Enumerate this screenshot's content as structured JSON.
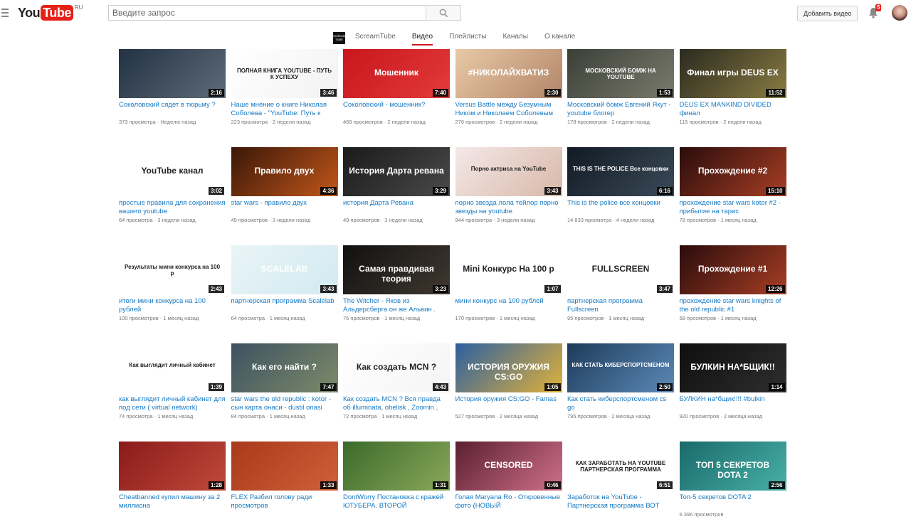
{
  "header": {
    "logo_you": "You",
    "logo_tube": "Tube",
    "logo_region": "RU",
    "search_placeholder": "Введите запрос",
    "upload_label": "Добавить видео",
    "notification_count": "5"
  },
  "channel": {
    "name": "ScreamTube",
    "thumb_text": "SCREAM TUBE",
    "tabs": [
      "Видео",
      "Плейлисты",
      "Каналы",
      "О канале"
    ],
    "active_tab": "Видео"
  },
  "videos": [
    {
      "title": "Соколовский сядет в тюрьму ?",
      "views": "373 просмотра",
      "age": "Неделю назад",
      "duration": "2:16",
      "thumb_text": "",
      "thumb_colors": [
        "#223244",
        "#5f6b78"
      ]
    },
    {
      "title": "Наше мнение о книге Николая Соболева - \"YouTube: Путь к",
      "views": "223 просмотра",
      "age": "2 недели назад",
      "duration": "3:46",
      "thumb_text": "ПОЛНАЯ КНИГА YOUTUBE - ПУТЬ К УСПЕХУ",
      "thumb_colors": [
        "#ffffff",
        "#f2f2f2"
      ]
    },
    {
      "title": "Соколовский - мошенник?",
      "views": "469 просмотров",
      "age": "2 недели назад",
      "duration": "7:40",
      "thumb_text": "Мошенник",
      "thumb_colors": [
        "#c8161d",
        "#e33b3b"
      ]
    },
    {
      "title": "Versus Battle между Безумным Ником и Николаем Соболевым",
      "views": "276 просмотров",
      "age": "2 недели назад",
      "duration": "2:30",
      "thumb_text": "#НИКОЛАЙХВАТИЗ",
      "thumb_colors": [
        "#e8c9a6",
        "#b3866a"
      ]
    },
    {
      "title": "Московский бомж Евгений Якут - youtube блогер",
      "views": "178 просмотров",
      "age": "2 недели назад",
      "duration": "1:53",
      "thumb_text": "МОСКОВСКИЙ БОМЖ НА YOUTUBE",
      "thumb_colors": [
        "#3b3f36",
        "#7a7b6e"
      ]
    },
    {
      "title": "DEUS EX MANKIND DIVIDED финал",
      "views": "115 просмотров",
      "age": "2 недели назад",
      "duration": "11:52",
      "thumb_text": "Финал игры DEUS EX",
      "thumb_colors": [
        "#2a2a1f",
        "#8a7c43"
      ]
    },
    {
      "title": "простые правила для сохранения вашего youtube",
      "views": "64 просмотра",
      "age": "3 недели назад",
      "duration": "3:02",
      "thumb_text": "YouTube канал",
      "thumb_colors": [
        "#ffffff",
        "#ffffff"
      ]
    },
    {
      "title": "star wars - правило двух",
      "views": "49 просмотров",
      "age": "3 недели назад",
      "duration": "4:36",
      "thumb_text": "Правило двух",
      "thumb_colors": [
        "#3a1708",
        "#c2561a"
      ]
    },
    {
      "title": "история Дарта Ревана",
      "views": "49 просмотров",
      "age": "3 недели назад",
      "duration": "3:29",
      "thumb_text": "История Дарта ревана",
      "thumb_colors": [
        "#1a1a1a",
        "#4a4a4a"
      ]
    },
    {
      "title": "порно звезда лола тейлор порно звезды на youtube",
      "views": "944 просмотра",
      "age": "3 недели назад",
      "duration": "3:43",
      "thumb_text": "Порно актриса на YouTube",
      "thumb_colors": [
        "#f4e8e8",
        "#d8b8a8"
      ]
    },
    {
      "title": "This is the police все концовки",
      "views": "14 833 просмотра",
      "age": "4 недели назад",
      "duration": "6:16",
      "thumb_text": "THIS IS THE POLICE Все концовки",
      "thumb_colors": [
        "#101a24",
        "#3c4a58"
      ]
    },
    {
      "title": "прохождение star wars kotor #2 - прибытие на тарис",
      "views": "78 просмотров",
      "age": "1 месяц назад",
      "duration": "15:10",
      "thumb_text": "Прохождение #2",
      "thumb_colors": [
        "#2a0c0c",
        "#a83e24"
      ]
    },
    {
      "title": "итоги мини конкурса на 100 рублей",
      "views": "100 просмотров",
      "age": "1 месяц назад",
      "duration": "2:43",
      "thumb_text": "Результаты мини конкурса на 100 р",
      "thumb_colors": [
        "#ffffff",
        "#ffffff"
      ]
    },
    {
      "title": "партнерская программа Scalelab",
      "views": "64 просмотра",
      "age": "1 месяц назад",
      "duration": "3:43",
      "thumb_text": "SCALELAB",
      "thumb_colors": [
        "#e9f4f7",
        "#d2eaf1"
      ]
    },
    {
      "title": "The Witcher - Яков из Альдерсберга он же Альвин .",
      "views": "76 просмотров",
      "age": "1 месяц назад",
      "duration": "3:23",
      "thumb_text": "Самая правдивая теория",
      "thumb_colors": [
        "#111111",
        "#403830"
      ]
    },
    {
      "title": "мини конкурс на 100 рублей",
      "views": "170 просмотров",
      "age": "1 месяц назад",
      "duration": "1:07",
      "thumb_text": "Mini Конкурс На 100 р",
      "thumb_colors": [
        "#ffffff",
        "#ffffff"
      ]
    },
    {
      "title": "партнерская программа Fullscreen",
      "views": "95 просмотров",
      "age": "1 месяц назад",
      "duration": "3:47",
      "thumb_text": "FULLSCREEN",
      "thumb_colors": [
        "#ffffff",
        "#ffffff"
      ]
    },
    {
      "title": "прохождение star wars knights of the old republic #1",
      "views": "58 просмотров",
      "age": "1 месяц назад",
      "duration": "12:26",
      "thumb_text": "Прохождение #1",
      "thumb_colors": [
        "#2a0c0c",
        "#a83e24"
      ]
    },
    {
      "title": "как выглядит личный кабинет для под сети ( virtual network)",
      "views": "74 просмотра",
      "age": "1 месяц назад",
      "duration": "1:39",
      "thumb_text": "Как выглядит личный кабинет",
      "thumb_colors": [
        "#ffffff",
        "#ffffff"
      ]
    },
    {
      "title": "star wars the old republic : kotor - сын карта онаси - dustil onasi",
      "views": "84 просмотра",
      "age": "1 месяц назад",
      "duration": "7:47",
      "thumb_text": "Как его найти ?",
      "thumb_colors": [
        "#3d5160",
        "#7d8b6a"
      ]
    },
    {
      "title": "Как создать MCN ? Вся правда об illuminata, obelisk , Zoomin ,",
      "views": "72 просмотра",
      "age": "1 месяц назад",
      "duration": "4:43",
      "thumb_text": "Как создать MCN ?",
      "thumb_colors": [
        "#ffffff",
        "#f4f4f4"
      ]
    },
    {
      "title": "История оружия CS:GO - Famas",
      "views": "527 просмотров",
      "age": "2 месяца назад",
      "duration": "1:05",
      "thumb_text": "ИСТОРИЯ ОРУЖИЯ CS:GO",
      "thumb_colors": [
        "#2c5fa0",
        "#e2b23a"
      ]
    },
    {
      "title": "Как стать киберспортсменом cs go",
      "views": "795 просмотров",
      "age": "2 месяца назад",
      "duration": "2:50",
      "thumb_text": "КАК СТАТЬ КИБЕРСПОРТСМЕНОМ",
      "thumb_colors": [
        "#1d3b5a",
        "#5c8ab8"
      ]
    },
    {
      "title": "БУЛКИН на*бщик!!!! #bulkin",
      "views": "920 просмотров",
      "age": "2 месяца назад",
      "duration": "1:14",
      "thumb_text": "БУЛКИН НА*БЩИК!!",
      "thumb_colors": [
        "#0f0f0f",
        "#2e2e2e"
      ]
    },
    {
      "title": "Cheatbanned купил машину за 2 миллиона",
      "views": "",
      "age": "",
      "duration": "1:28",
      "thumb_text": "",
      "thumb_colors": [
        "#8a1a1a",
        "#c04a3a"
      ]
    },
    {
      "title": "FLEX Разбил голову ради просмотров",
      "views": "",
      "age": "",
      "duration": "1:33",
      "thumb_text": "",
      "thumb_colors": [
        "#a83a1a",
        "#d0603a"
      ]
    },
    {
      "title": "DontWorry Постановка с кражей ЮТУБЕРА. ВТОРОЙ",
      "views": "",
      "age": "",
      "duration": "1:31",
      "thumb_text": "",
      "thumb_colors": [
        "#3b6a2a",
        "#8aa85a"
      ]
    },
    {
      "title": "Голая Maryana Ro - Откровенные фото (НОВЫЙ",
      "views": "",
      "age": "",
      "duration": "0:46",
      "thumb_text": "CENSORED",
      "thumb_colors": [
        "#5a2030",
        "#d0708a"
      ]
    },
    {
      "title": "Заработок на YouTube - Партнерская программа ВОТ",
      "views": "",
      "age": "",
      "duration": "6:51",
      "thumb_text": "КАК ЗАРАБОТАТЬ НА YOUTUBE ПАРТНЕРСКАЯ ПРОГРАММА",
      "thumb_colors": [
        "#ffffff",
        "#ffffff"
      ]
    },
    {
      "title": "Топ-5 секретов DOTA 2",
      "views": "6 396 просмотров",
      "age": "",
      "duration": "2:56",
      "thumb_text": "ТОП 5 СЕКРЕТОВ DOTA 2",
      "thumb_colors": [
        "#1a6a6a",
        "#48b0a8"
      ]
    }
  ]
}
